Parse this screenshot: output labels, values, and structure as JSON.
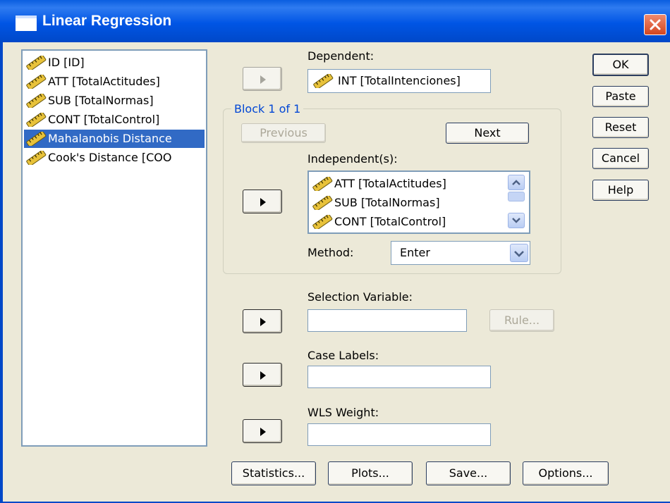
{
  "window": {
    "title": "Linear Regression",
    "title_bar_color": "#0055e5",
    "close_icon": "close-icon"
  },
  "variable_list": {
    "items": [
      {
        "label": "ID [ID]",
        "selected": false,
        "icon": "scale-variable-icon"
      },
      {
        "label": "ATT [TotalActitudes]",
        "selected": false,
        "icon": "scale-variable-icon"
      },
      {
        "label": "SUB [TotalNormas]",
        "selected": false,
        "icon": "scale-variable-icon"
      },
      {
        "label": "CONT [TotalControl]",
        "selected": false,
        "icon": "scale-variable-icon"
      },
      {
        "label": "Mahalanobis Distance",
        "selected": true,
        "icon": "scale-variable-icon"
      },
      {
        "label": "Cook's Distance [COO",
        "selected": false,
        "icon": "scale-variable-icon"
      }
    ],
    "selected_color": "#316ac5"
  },
  "dependent": {
    "label": "Dependent:",
    "value": "INT [TotalIntenciones]"
  },
  "block": {
    "legend": "Block 1 of 1",
    "previous_label": "Previous",
    "next_label": "Next",
    "independents_label": "Independent(s):",
    "independents": [
      "ATT [TotalActitudes]",
      "SUB [TotalNormas]",
      "CONT [TotalControl]"
    ],
    "method_label": "Method:",
    "method_value": "Enter"
  },
  "selection_variable": {
    "label": "Selection Variable:",
    "value": "",
    "rule_label": "Rule..."
  },
  "case_labels": {
    "label": "Case Labels:",
    "value": ""
  },
  "wls_weight": {
    "label": "WLS Weight:",
    "value": ""
  },
  "side_buttons": {
    "ok": "OK",
    "paste": "Paste",
    "reset": "Reset",
    "cancel": "Cancel",
    "help": "Help"
  },
  "bottom_buttons": {
    "statistics": "Statistics...",
    "plots": "Plots...",
    "save": "Save...",
    "options": "Options..."
  }
}
